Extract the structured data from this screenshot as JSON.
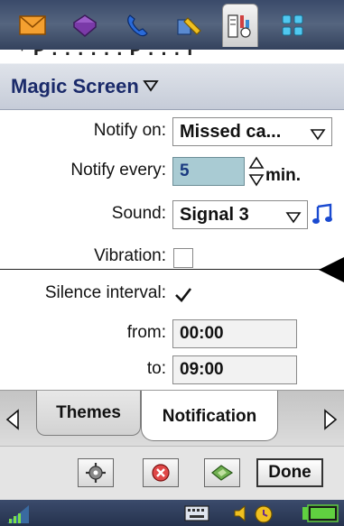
{
  "appbar": {
    "apps": [
      {
        "icon": "mail-icon"
      },
      {
        "icon": "contacts-book-icon"
      },
      {
        "icon": "phone-icon"
      },
      {
        "icon": "tools-icon"
      },
      {
        "icon": "control-panel-icon",
        "active": true
      },
      {
        "icon": "app-grid-icon"
      }
    ],
    "peek_text": "* P  .  .  .  .  .  .  P . . . f"
  },
  "title": {
    "text": "Magic Screen"
  },
  "form": {
    "notify_on": {
      "label": "Notify on:",
      "value": "Missed ca..."
    },
    "notify_every": {
      "label": "Notify every:",
      "value": "5",
      "unit": "min."
    },
    "sound": {
      "label": "Sound:",
      "value": "Signal 3",
      "icon": "music-note-icon"
    },
    "vibration": {
      "label": "Vibration:",
      "checked": false
    },
    "silence_interval": {
      "label": "Silence interval:",
      "checked": true
    },
    "from": {
      "label": "from:",
      "value": "00:00"
    },
    "to": {
      "label": "to:",
      "value": "09:00"
    }
  },
  "tabs": [
    {
      "label": "Themes",
      "active": false
    },
    {
      "label": "Notification",
      "active": true
    }
  ],
  "actions": {
    "done_label": "Done",
    "buttons": [
      "settings-gear-icon",
      "delete-icon",
      "edit-icon"
    ]
  },
  "statusbar": {
    "icons": [
      "signal-strength-icon",
      "keyboard-icon",
      "volume-icon",
      "alarm-icon",
      "battery-icon"
    ]
  },
  "colors": {
    "title_text": "#1a2a6a",
    "focus_field": "#a9cbd3",
    "bar_blue": "#3a4a6a"
  }
}
